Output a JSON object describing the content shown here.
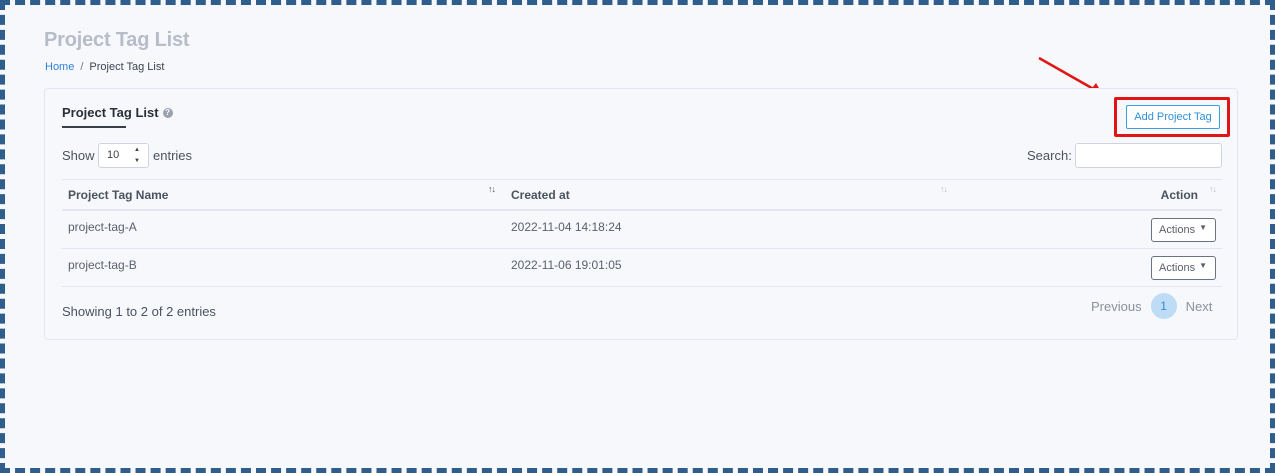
{
  "page": {
    "title": "Project Tag List",
    "breadcrumb": {
      "home": "Home",
      "separator": "/",
      "current": "Project Tag List"
    }
  },
  "card": {
    "title": "Project Tag List",
    "help_icon": "question-circle-icon",
    "add_button_label": "Add Project Tag"
  },
  "controls": {
    "show_label": "Show",
    "entries_value": "10",
    "entries_label": "entries",
    "search_label": "Search:",
    "search_value": ""
  },
  "table": {
    "columns": [
      "Project Tag Name",
      "Created at",
      "Action"
    ],
    "rows": [
      {
        "name": "project-tag-A",
        "created_at": "2022-11-04 14:18:24",
        "action_label": "Actions"
      },
      {
        "name": "project-tag-B",
        "created_at": "2022-11-06 19:01:05",
        "action_label": "Actions"
      }
    ]
  },
  "footer": {
    "showing": "Showing 1 to 2 of 2 entries",
    "prev": "Previous",
    "current_page": "1",
    "next": "Next"
  },
  "colors": {
    "highlight": "#e01515",
    "accent": "#2f8fd8",
    "frame_border": "#2f5d8c"
  }
}
